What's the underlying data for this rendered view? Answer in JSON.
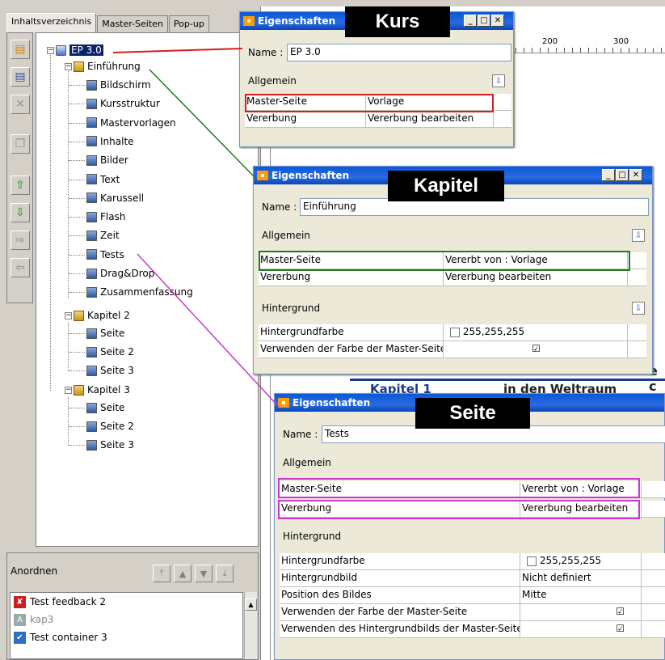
{
  "left_panel": {
    "tabs": [
      "Inhaltsverzeichnis",
      "Master-Seiten",
      "Pop-up"
    ],
    "tree": {
      "root": "EP 3.0",
      "chapter1": "Einführung",
      "chapter1_pages": [
        "Bildschirm",
        "Kursstruktur",
        "Mastervorlagen",
        "Inhalte",
        "Bilder",
        "Text",
        "Karussell",
        "Flash",
        "Zeit",
        "Tests",
        "Drag&Drop",
        "Zusammenfassung"
      ],
      "chapter2": "Kapitel 2",
      "chapter2_pages": [
        "Seite",
        "Seite 2",
        "Seite 3"
      ],
      "chapter3": "Kapitel 3",
      "chapter3_pages": [
        "Seite",
        "Seite 2",
        "Seite 3"
      ]
    }
  },
  "arrange_panel": {
    "title": "Anordnen",
    "items": [
      "Test feedback 2",
      "kap3",
      "Test container 3"
    ]
  },
  "editor": {
    "ruler_marks": [
      "200",
      "300"
    ],
    "bg_text_1": "Kapitel 1",
    "bg_text_2": "in den Weltraum gescho",
    "bg_text_3": "e c"
  },
  "dialog_kurs": {
    "title": "Eigenschaften",
    "overlay_label": "Kurs",
    "name_label": "Name :",
    "name_value": "EP 3.0",
    "section_allgemein": "Allgemein",
    "rows": [
      {
        "key": "Master-Seite",
        "value": "Vorlage"
      },
      {
        "key": "Vererbung",
        "value": "Vererbung bearbeiten"
      }
    ]
  },
  "dialog_kapitel": {
    "title": "Eigenschaften",
    "overlay_label": "Kapitel",
    "name_label": "Name :",
    "name_value": "Einführung",
    "section_allgemein": "Allgemein",
    "rows": [
      {
        "key": "Master-Seite",
        "value": "Vererbt von : Vorlage"
      },
      {
        "key": "Vererbung",
        "value": "Vererbung bearbeiten"
      }
    ],
    "section_hintergrund": "Hintergrund",
    "bg_rows": [
      {
        "key": "Hintergrundfarbe",
        "value": "255,255,255"
      },
      {
        "key": "Verwenden der Farbe der Master-Seite",
        "value": "☑"
      }
    ]
  },
  "dialog_seite": {
    "title": "Eigenschaften",
    "overlay_label": "Seite",
    "name_label": "Name :",
    "name_value": "Tests",
    "section_allgemein": "Allgemein",
    "rows": [
      {
        "key": "Master-Seite",
        "value": "Vererbt von : Vorlage"
      },
      {
        "key": "Vererbung",
        "value": "Vererbung bearbeiten"
      }
    ],
    "section_hintergrund": "Hintergrund",
    "bg_rows": [
      {
        "key": "Hintergrundfarbe",
        "value": "255,255,255"
      },
      {
        "key": "Hintergrundbild",
        "value": "Nicht definiert"
      },
      {
        "key": "Position des Bildes",
        "value": "Mitte"
      },
      {
        "key": "Verwenden der Farbe der Master-Seite",
        "value": "☑"
      },
      {
        "key": "Verwenden des Hintergrundbilds der Master-Seite",
        "value": "☑"
      }
    ]
  },
  "colors": {
    "kurs_highlight": "#d81e1e",
    "kapitel_highlight": "#1e7a1e",
    "seite_highlight": "#c838c8"
  }
}
